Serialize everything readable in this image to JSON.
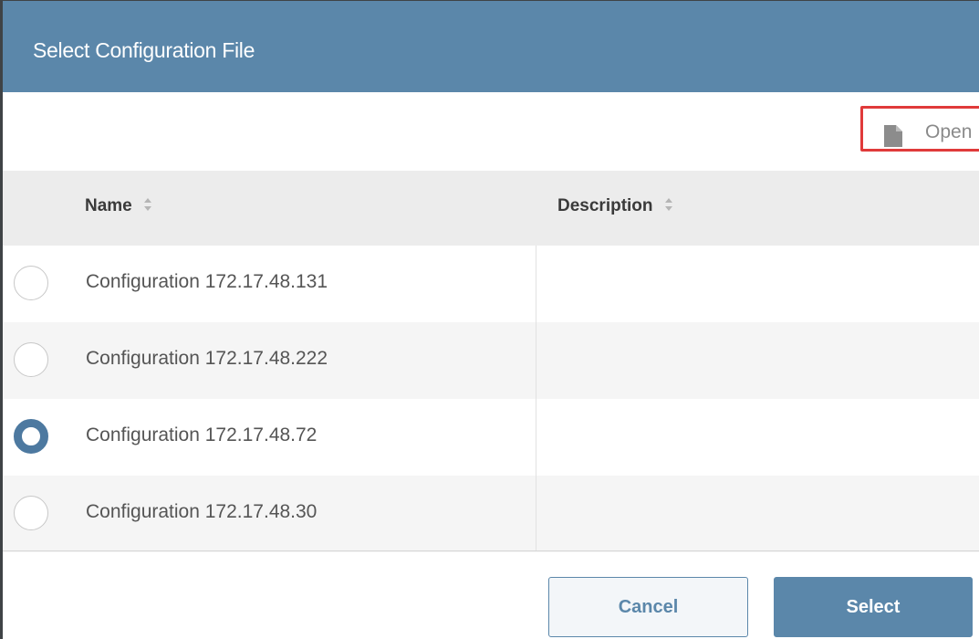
{
  "dialog": {
    "title": "Select Configuration File"
  },
  "toolbar": {
    "open_label": "Open",
    "open_icon": "file-icon"
  },
  "grid": {
    "columns": [
      {
        "label": "Name",
        "sort_icon": "sort-icon"
      },
      {
        "label": "Description",
        "sort_icon": "sort-icon"
      }
    ],
    "rows": [
      {
        "name": "Configuration 172.17.48.131",
        "description": "",
        "selected": false
      },
      {
        "name": "Configuration 172.17.48.222",
        "description": "",
        "selected": false
      },
      {
        "name": "Configuration 172.17.48.72",
        "description": "",
        "selected": true
      },
      {
        "name": "Configuration 172.17.48.30",
        "description": "",
        "selected": false
      }
    ]
  },
  "footer": {
    "cancel_label": "Cancel",
    "select_label": "Select"
  },
  "colors": {
    "accent": "#5b87aa",
    "radio_checked": "#4d79a0",
    "highlight_border": "#e03a3a"
  }
}
